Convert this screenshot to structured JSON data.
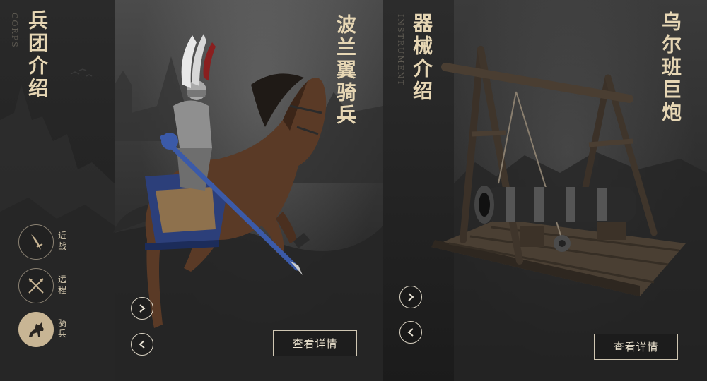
{
  "corps": {
    "title": "兵团介绍",
    "subtitle": "CORPS",
    "unit_name": "波兰翼骑兵",
    "detail_label": "查看详情",
    "categories": [
      {
        "label": "近战",
        "icon": "sword-icon",
        "active": false
      },
      {
        "label": "远程",
        "icon": "crossed-arrows-icon",
        "active": false
      },
      {
        "label": "骑兵",
        "icon": "horse-icon",
        "active": true
      }
    ]
  },
  "instrument": {
    "title": "器械介绍",
    "subtitle": "INSTRUMENT",
    "unit_name": "乌尔班巨炮",
    "detail_label": "查看详情"
  },
  "colors": {
    "accent": "#c8b594",
    "title_text": "#e6d6b4",
    "panel_dark": "#232323"
  }
}
